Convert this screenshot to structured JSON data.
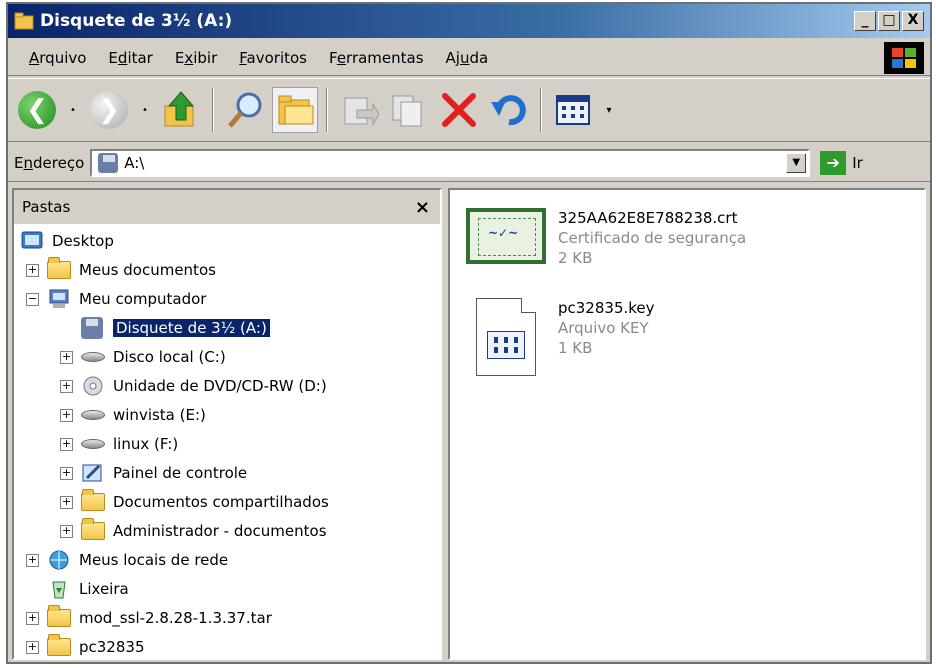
{
  "window": {
    "title": "Disquete de 3½ (A:)",
    "min_label": "_",
    "max_label": "□",
    "close_label": "X"
  },
  "menu": [
    {
      "pre": "",
      "u": "A",
      "post": "rquivo"
    },
    {
      "pre": "E",
      "u": "d",
      "post": "itar"
    },
    {
      "pre": "E",
      "u": "x",
      "post": "ibir"
    },
    {
      "pre": "",
      "u": "F",
      "post": "avoritos"
    },
    {
      "pre": "F",
      "u": "e",
      "post": "rramentas"
    },
    {
      "pre": "Aj",
      "u": "u",
      "post": "da"
    }
  ],
  "toolbar": {
    "icons": [
      "back-icon",
      "forward-icon",
      "up-folder-icon",
      "search-icon",
      "folders-icon",
      "move-to-icon",
      "copy-to-icon",
      "delete-icon",
      "undo-icon",
      "views-icon"
    ]
  },
  "address": {
    "label_pre": "E",
    "label_u": "n",
    "label_post": "dereço",
    "value": "A:\\",
    "go_label": "Ir"
  },
  "folders": {
    "header": "Pastas",
    "close": "×",
    "tree": [
      {
        "label": "Desktop",
        "level": 0,
        "expander": "",
        "icon": "desktop-icon"
      },
      {
        "label": "Meus documentos",
        "level": 1,
        "expander": "+",
        "icon": "folder-icon"
      },
      {
        "label": "Meu computador",
        "level": 1,
        "expander": "−",
        "icon": "computer-icon"
      },
      {
        "label": "Disquete de 3½ (A:)",
        "level": 2,
        "expander": "",
        "icon": "floppy-icon",
        "selected": true
      },
      {
        "label": "Disco local (C:)",
        "level": 2,
        "expander": "+",
        "icon": "drive-icon"
      },
      {
        "label": "Unidade de DVD/CD-RW (D:)",
        "level": 2,
        "expander": "+",
        "icon": "cd-drive-icon"
      },
      {
        "label": "winvista (E:)",
        "level": 2,
        "expander": "+",
        "icon": "drive-icon"
      },
      {
        "label": "linux (F:)",
        "level": 2,
        "expander": "+",
        "icon": "drive-icon"
      },
      {
        "label": "Painel de controle",
        "level": 2,
        "expander": "+",
        "icon": "control-panel-icon"
      },
      {
        "label": "Documentos compartilhados",
        "level": 2,
        "expander": "+",
        "icon": "folder-icon"
      },
      {
        "label": "Administrador - documentos",
        "level": 2,
        "expander": "+",
        "icon": "folder-icon"
      },
      {
        "label": "Meus locais de rede",
        "level": 1,
        "expander": "+",
        "icon": "network-icon"
      },
      {
        "label": "Lixeira",
        "level": 1,
        "expander": "",
        "icon": "recycle-bin-icon"
      },
      {
        "label": "mod_ssl-2.8.28-1.3.37.tar",
        "level": 1,
        "expander": "+",
        "icon": "folder-icon"
      },
      {
        "label": "pc32835",
        "level": 1,
        "expander": "+",
        "icon": "folder-icon"
      }
    ]
  },
  "files": [
    {
      "name": "325AA62E8E788238.crt",
      "type": "Certificado de segurança",
      "size": "2 KB",
      "icon": "certificate-icon"
    },
    {
      "name": "pc32835.key",
      "type": "Arquivo KEY",
      "size": "1 KB",
      "icon": "key-file-icon"
    }
  ]
}
